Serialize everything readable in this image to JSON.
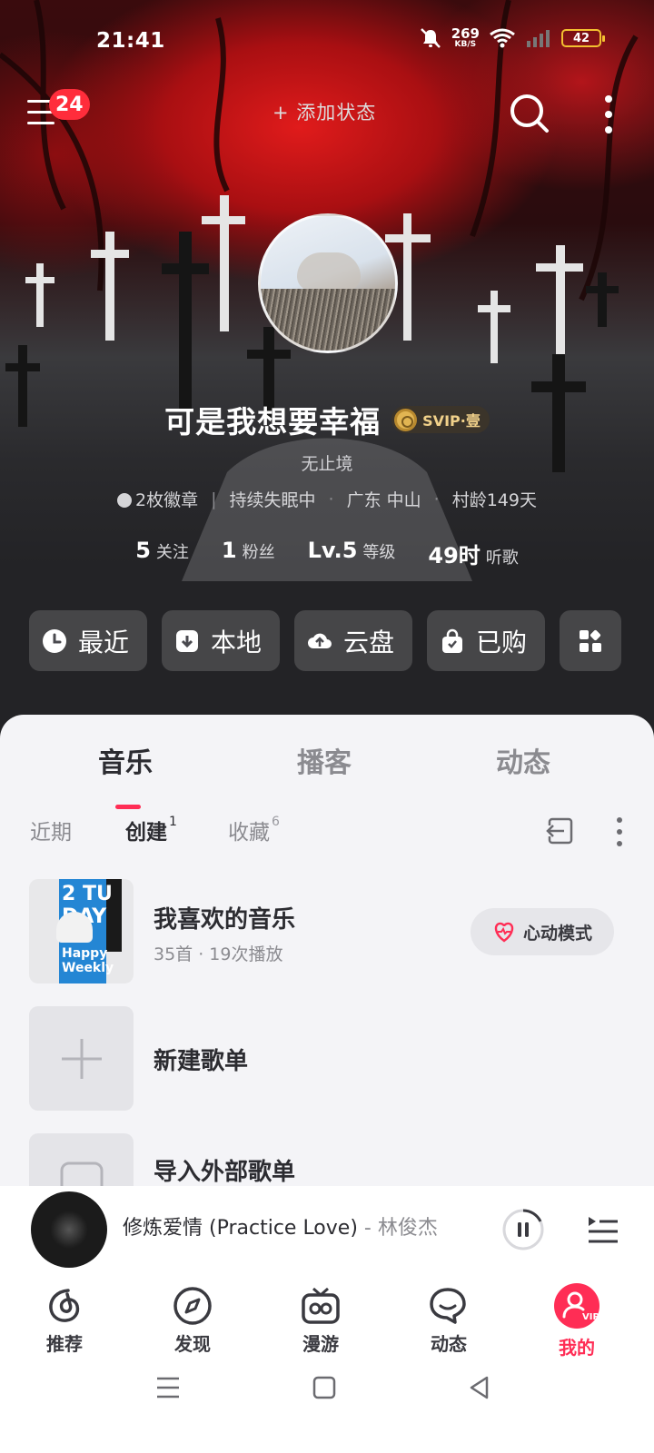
{
  "status_bar": {
    "time": "21:41",
    "net_speed": "269",
    "net_unit": "KB/S",
    "battery": "42"
  },
  "top_bar": {
    "badge_count": "24",
    "add_status": "添加状态"
  },
  "profile": {
    "name": "可是我想要幸福",
    "vip": "SVIP·壹",
    "signature": "无止境",
    "badges": "2枚徽章",
    "mood": "持续失眠中",
    "location": "广东 中山",
    "age": "村龄149天",
    "stats": [
      {
        "num": "5",
        "label": "关注"
      },
      {
        "num": "1",
        "label": "粉丝"
      },
      {
        "num": "Lv.5",
        "label": "等级"
      },
      {
        "num": "49时",
        "label": "听歌"
      }
    ]
  },
  "quick_actions": [
    {
      "label": "最近",
      "icon": "clock-icon"
    },
    {
      "label": "本地",
      "icon": "download-box-icon"
    },
    {
      "label": "云盘",
      "icon": "cloud-upload-icon"
    },
    {
      "label": "已购",
      "icon": "shopping-bag-icon"
    }
  ],
  "tabs": [
    "音乐",
    "播客",
    "动态"
  ],
  "subtabs": [
    {
      "label": "近期",
      "count": ""
    },
    {
      "label": "创建",
      "count": "1"
    },
    {
      "label": "收藏",
      "count": "6"
    }
  ],
  "playlists": [
    {
      "title": "我喜欢的音乐",
      "meta": "35首 · 19次播放",
      "action": "心动模式"
    },
    {
      "title": "新建歌单"
    },
    {
      "title": "导入外部歌单"
    }
  ],
  "cover_text": {
    "line1": "2 TU DAY",
    "line2": "Happy Weekly"
  },
  "player": {
    "song": "修炼爱情 (Practice Love)",
    "artist": " - 林俊杰"
  },
  "nav": [
    {
      "label": "推荐",
      "icon": "netease-logo-icon"
    },
    {
      "label": "发现",
      "icon": "compass-icon"
    },
    {
      "label": "漫游",
      "icon": "radio-icon"
    },
    {
      "label": "动态",
      "icon": "chat-bubble-icon"
    },
    {
      "label": "我的",
      "icon": "user-vip-icon"
    }
  ],
  "colors": {
    "accent": "#ff2d55",
    "badge": "#ff2d3b",
    "vip_gold": "#f1d18a"
  }
}
